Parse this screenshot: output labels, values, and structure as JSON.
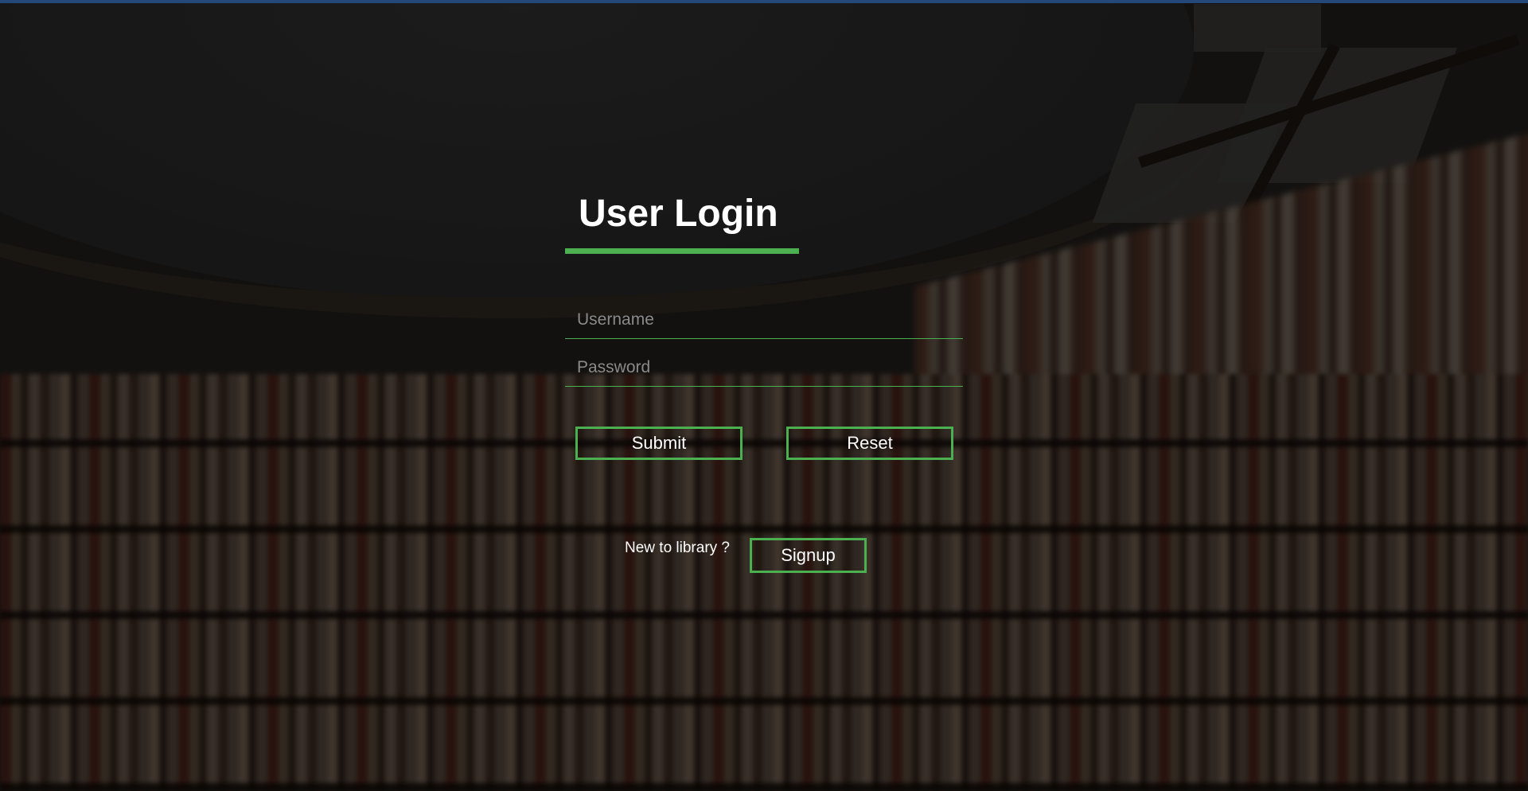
{
  "login": {
    "title": "User Login",
    "username_placeholder": "Username",
    "password_placeholder": "Password",
    "submit_label": "Submit",
    "reset_label": "Reset",
    "signup_prompt": "New to library ?",
    "signup_label": "Signup"
  },
  "colors": {
    "accent": "#4caf50",
    "top_bar": "#24487a",
    "text": "#ffffff"
  }
}
